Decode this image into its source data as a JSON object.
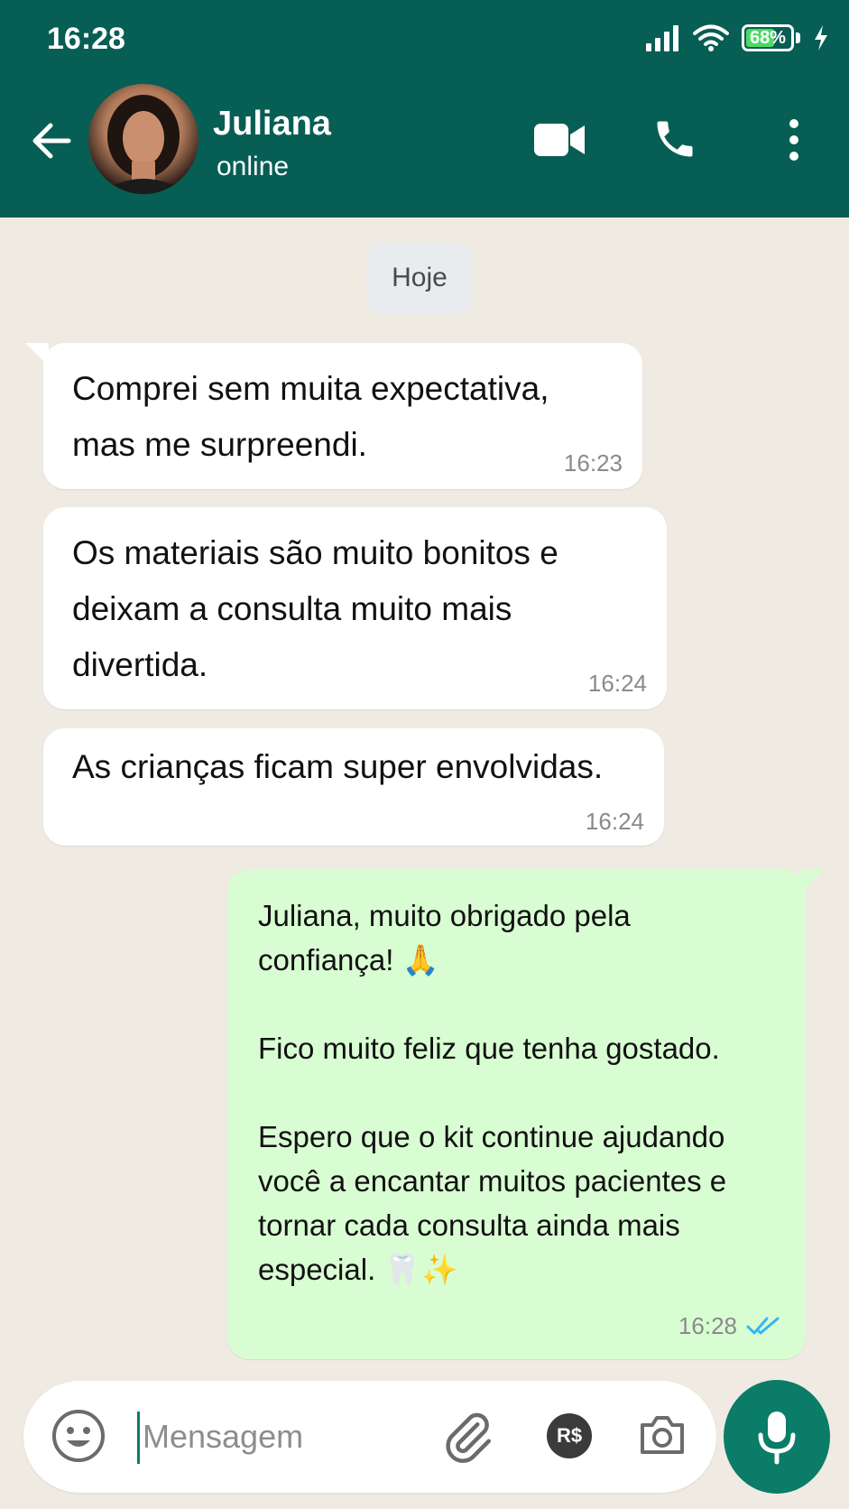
{
  "status_bar": {
    "time": "16:28",
    "battery": "68%",
    "battery_level": 0.68
  },
  "header": {
    "contact_name": "Juliana",
    "contact_status": "online",
    "icons": [
      "back-arrow-icon",
      "video-call-icon",
      "phone-call-icon",
      "more-options-icon"
    ]
  },
  "chat": {
    "date_chip": "Hoje",
    "messages": [
      {
        "direction": "in",
        "text": "Comprei sem muita expectativa,\nmas me surpreendi.",
        "time": "16:23"
      },
      {
        "direction": "in",
        "text": "Os materiais são muito bonitos e\ndeixam a consulta muito mais\ndivertida.",
        "time": "16:24"
      },
      {
        "direction": "in",
        "text": "As crianças ficam super envolvidas.",
        "time": "16:24"
      },
      {
        "direction": "out",
        "text": "Juliana, muito obrigado pela\nconfiança! 🙏\n\nFico muito feliz que tenha gostado.\n\nEspero que o kit continue ajudando\nvocê a encantar muitos pacientes e\ntornar cada consulta ainda mais\nespecial. 🦷✨",
        "time": "16:28",
        "status": "read"
      }
    ]
  },
  "input_bar": {
    "placeholder": "Mensagem",
    "value": "",
    "payment_label": "R$",
    "icons": [
      "emoji-icon",
      "attach-icon",
      "payment-icon",
      "camera-icon",
      "microphone-icon"
    ]
  },
  "colors": {
    "header_bg": "#075e54",
    "chat_bg": "#efeae2",
    "incoming_bubble": "#ffffff",
    "outgoing_bubble": "#d9fdd3",
    "read_ticks": "#34b7f1",
    "mic_button": "#0a7c68"
  }
}
